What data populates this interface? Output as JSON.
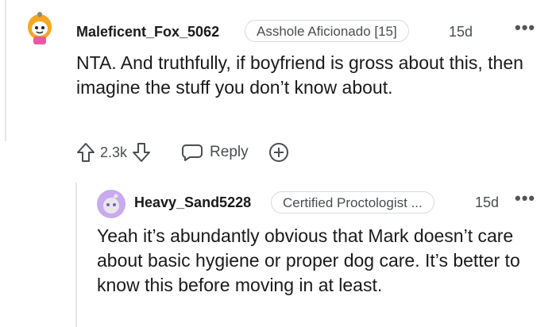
{
  "comment": {
    "username": "Maleficent_Fox_5062",
    "flair": "Asshole Aficionado [15]",
    "time": "15d",
    "body": "NTA. And truthfully, if boyfriend is gross about this, then imagine the stuff you don’t know about.",
    "votes": "2.3k",
    "reply_label": "Reply",
    "icons": {
      "avatar": "snoo-avatar",
      "upvote": "upvote-arrow-icon",
      "downvote": "downvote-arrow-icon",
      "reply": "speech-bubble-icon",
      "add": "plus-circle-icon",
      "more": "more-options-icon"
    }
  },
  "reply": {
    "username": "Heavy_Sand5228",
    "flair": "Certified Proctologist ...",
    "time": "15d",
    "body": "Yeah it’s abundantly obvious that Mark doesn’t care about basic hygiene or proper dog care. It’s better to know this before moving in at least.",
    "icons": {
      "avatar": "snoo-avatar-purple",
      "more": "more-options-icon"
    }
  },
  "colors": {
    "text": "#1a1a1b",
    "meta": "#4a4d50",
    "border": "#d7dadc",
    "thread_line": "#e3e5e8",
    "reply_avatar": "#c9a9f0"
  }
}
